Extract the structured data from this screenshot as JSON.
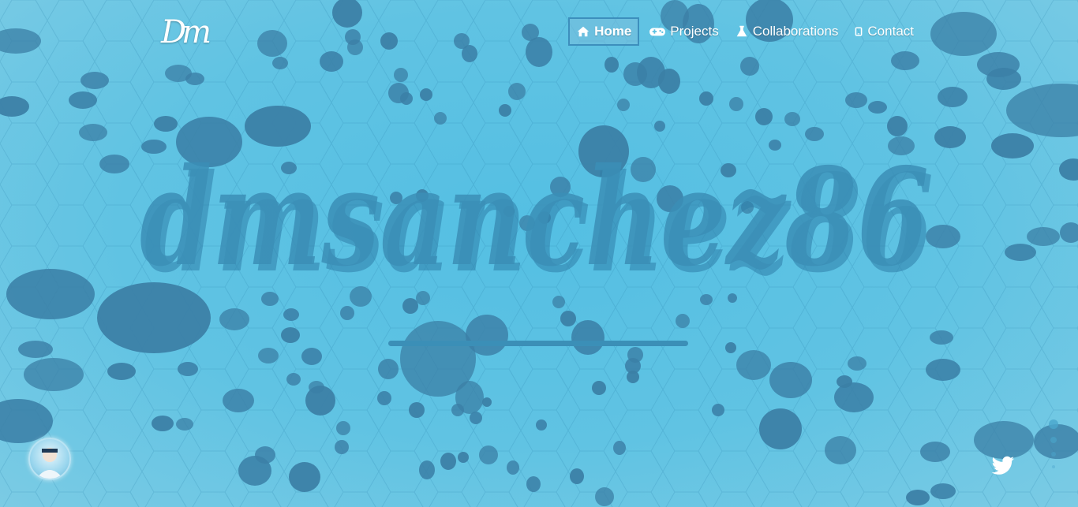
{
  "brand": {
    "logo_text": "Dm"
  },
  "nav": {
    "items": [
      {
        "label": "Home",
        "icon": "home-icon",
        "active": true
      },
      {
        "label": "Projects",
        "icon": "gamepad-icon",
        "active": false
      },
      {
        "label": "Collaborations",
        "icon": "flask-icon",
        "active": false
      },
      {
        "label": "Contact",
        "icon": "mobile-icon",
        "active": false
      }
    ]
  },
  "hero": {
    "title": "dmsanchez86"
  },
  "social": {
    "icon": "twitter-icon"
  },
  "colors": {
    "background": "#5ec2e2",
    "blob": "#3b7fa6",
    "title": "#3b8fb7",
    "nav_active_border": "#3d8fbd",
    "text": "#ffffff"
  }
}
